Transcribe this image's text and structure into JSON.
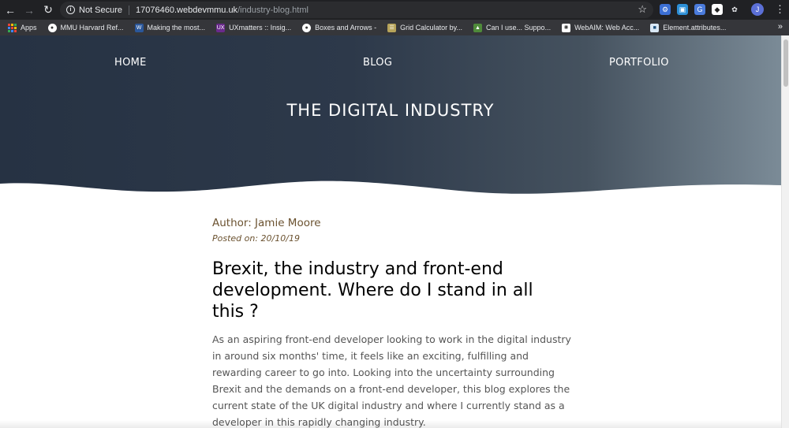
{
  "browser": {
    "security_label": "Not Secure",
    "url_host": "17076460.webdevmmu.uk",
    "url_path": "/industry-blog.html",
    "avatar_initial": "J"
  },
  "bookmarks": [
    {
      "label": "Apps"
    },
    {
      "label": "MMU Harvard Ref..."
    },
    {
      "label": "Making the most..."
    },
    {
      "label": "UXmatters :: Insig..."
    },
    {
      "label": "Boxes and Arrows -"
    },
    {
      "label": "Grid Calculator by..."
    },
    {
      "label": "Can I use... Suppo..."
    },
    {
      "label": "WebAIM: Web Acc..."
    },
    {
      "label": "Element.attributes..."
    }
  ],
  "site": {
    "nav": {
      "home": "HOME",
      "blog": "BLOG",
      "portfolio": "PORTFOLIO"
    },
    "hero_title": "THE DIGITAL INDUSTRY",
    "colors": {
      "hero_start": "#263243",
      "hero_end": "#7b8b97",
      "author": "#6b5230"
    }
  },
  "article": {
    "author": "Author: Jamie Moore",
    "posted": "Posted on: 20/10/19",
    "headline": "Brexit, the industry and front-end development. Where do I stand in all this ?",
    "body": "As an aspiring front-end developer looking to work in the digital industry in around six months' time, it feels like an exciting, fulfilling and rewarding career to go into. Looking into the uncertainty surrounding Brexit and the demands on a front-end developer, this blog explores the current state of the UK digital industry and where I currently stand as a developer in this rapidly changing industry."
  }
}
